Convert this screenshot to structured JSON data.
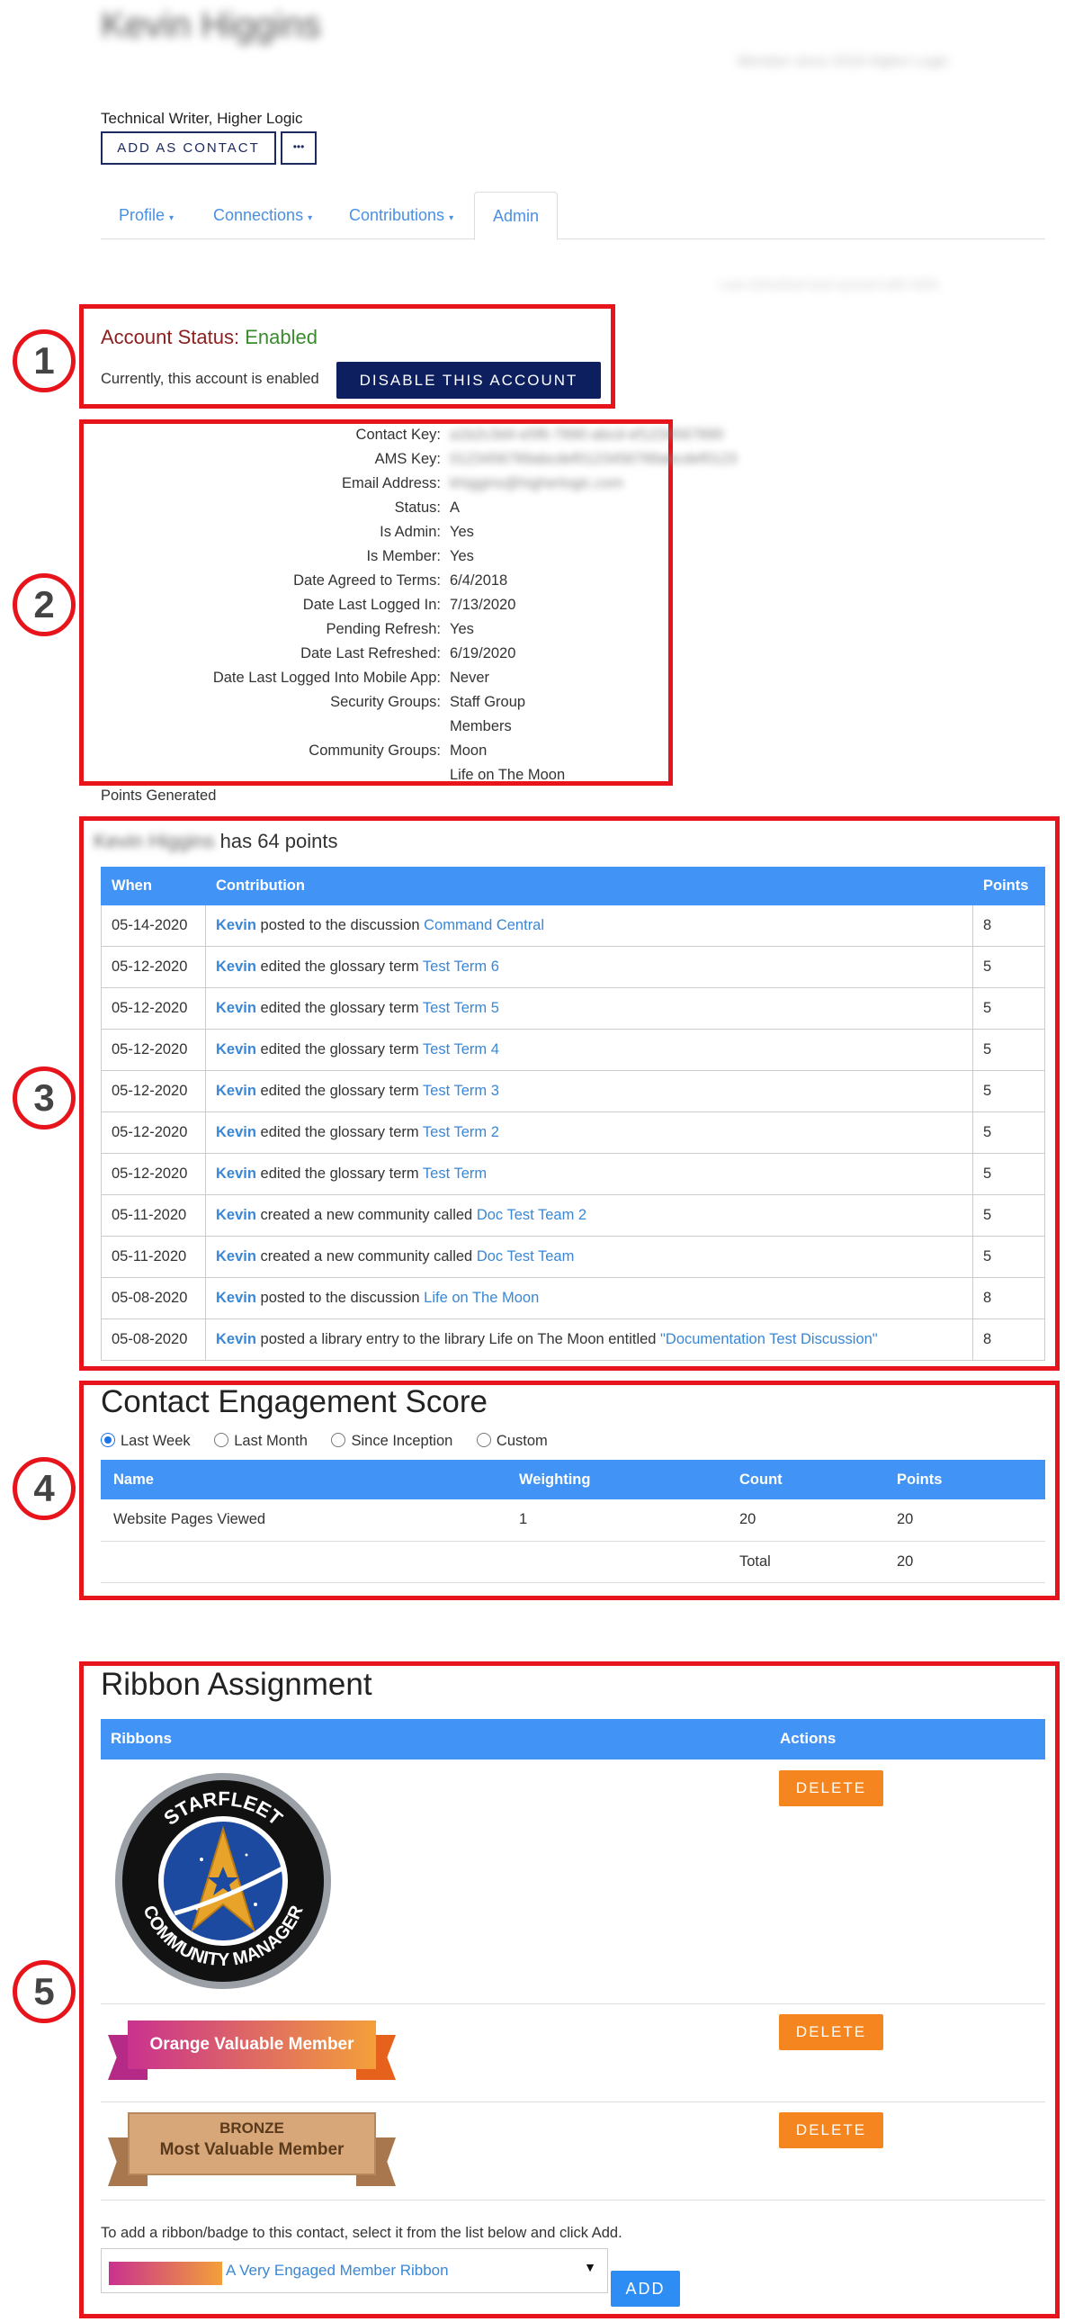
{
  "profile": {
    "name": "Kevin Higgins",
    "title": "Technical Writer, Higher Logic",
    "add_contact_label": "ADD AS CONTACT",
    "more_label": "•••",
    "top_right_blur": "Member since 2018 Higher Logic",
    "admin_right_blur": "Last refreshed and synced with AMS"
  },
  "tabs": [
    {
      "label": "Profile"
    },
    {
      "label": "Connections"
    },
    {
      "label": "Contributions"
    },
    {
      "label": "Admin"
    }
  ],
  "annotations": [
    "1",
    "2",
    "3",
    "4",
    "5"
  ],
  "account": {
    "status_label": "Account Status:",
    "status_value": "Enabled",
    "note": "Currently, this account is enabled",
    "disable_label": "DISABLE THIS ACCOUNT"
  },
  "details": [
    {
      "label": "Contact Key:",
      "value": "a1b2c3d4-e5f6-7890-abcd-ef1234567890"
    },
    {
      "label": "AMS Key:",
      "value": "0123456789abcdef0123456789abcdef0123"
    },
    {
      "label": "Email Address:",
      "value": "khiggins@higherlogic.com"
    },
    {
      "label": "Status:",
      "value": "A"
    },
    {
      "label": "Is Admin:",
      "value": "Yes"
    },
    {
      "label": "Is Member:",
      "value": "Yes"
    },
    {
      "label": "Date Agreed to Terms:",
      "value": "6/4/2018"
    },
    {
      "label": "Date Last Logged In:",
      "value": "7/13/2020"
    },
    {
      "label": "Pending Refresh:",
      "value": "Yes"
    },
    {
      "label": "Date Last Refreshed:",
      "value": "6/19/2020"
    },
    {
      "label": "Date Last Logged Into Mobile App:",
      "value": "Never"
    },
    {
      "label": "Security Groups:",
      "value": "Staff Group"
    },
    {
      "label": "",
      "value": "Members"
    },
    {
      "label": "Community Groups:",
      "value": "Moon"
    },
    {
      "label": "",
      "value": "Life on The Moon"
    }
  ],
  "points": {
    "section_label": "Points Generated",
    "summary_name": "Kevin Higgins",
    "summary_text": "has 64 points",
    "headers": {
      "when": "When",
      "contribution": "Contribution",
      "points": "Points"
    },
    "rows": [
      {
        "when": "05-14-2020",
        "who": "Kevin",
        "action": " posted to the discussion ",
        "target": "Command Central",
        "points": "8"
      },
      {
        "when": "05-12-2020",
        "who": "Kevin",
        "action": " edited the glossary term ",
        "target": "Test Term 6",
        "points": "5"
      },
      {
        "when": "05-12-2020",
        "who": "Kevin",
        "action": " edited the glossary term ",
        "target": "Test Term 5",
        "points": "5"
      },
      {
        "when": "05-12-2020",
        "who": "Kevin",
        "action": " edited the glossary term ",
        "target": "Test Term 4",
        "points": "5"
      },
      {
        "when": "05-12-2020",
        "who": "Kevin",
        "action": " edited the glossary term ",
        "target": "Test Term 3",
        "points": "5"
      },
      {
        "when": "05-12-2020",
        "who": "Kevin",
        "action": " edited the glossary term ",
        "target": "Test Term 2",
        "points": "5"
      },
      {
        "when": "05-12-2020",
        "who": "Kevin",
        "action": " edited the glossary term ",
        "target": "Test Term",
        "points": "5"
      },
      {
        "when": "05-11-2020",
        "who": "Kevin",
        "action": " created a new community called ",
        "target": "Doc Test Team 2",
        "points": "5"
      },
      {
        "when": "05-11-2020",
        "who": "Kevin",
        "action": " created a new community called ",
        "target": "Doc Test Team",
        "points": "5"
      },
      {
        "when": "05-08-2020",
        "who": "Kevin",
        "action": " posted to the discussion ",
        "target": "Life on The Moon",
        "points": "8"
      },
      {
        "when": "05-08-2020",
        "who": "Kevin",
        "action": " posted a library entry to the library Life on The Moon entitled ",
        "target": "\"Documentation Test Discussion\"",
        "points": "8"
      }
    ]
  },
  "engagement": {
    "title": "Contact Engagement Score",
    "ranges": [
      "Last Week",
      "Last Month",
      "Since Inception",
      "Custom"
    ],
    "selected_range": "Last Week",
    "headers": {
      "name": "Name",
      "weighting": "Weighting",
      "count": "Count",
      "points": "Points"
    },
    "row": {
      "name": "Website Pages Viewed",
      "weighting": "1",
      "count": "20",
      "points": "20"
    },
    "total_label": "Total",
    "total_points": "20"
  },
  "ribbons": {
    "title": "Ribbon Assignment",
    "headers": {
      "ribbons": "Ribbons",
      "actions": "Actions"
    },
    "delete_label": "DELETE",
    "badge": {
      "top": "STARFLEET",
      "bottom": "COMMUNITY MANAGER"
    },
    "orange": "Orange Valuable Member",
    "bronze_top": "BRONZE",
    "bronze_bottom": "Most Valuable Member",
    "instructions": "To add a ribbon/badge to this contact, select it from the list below and click Add.",
    "select_value": "A Very Engaged Member Ribbon",
    "add_label": "ADD"
  }
}
